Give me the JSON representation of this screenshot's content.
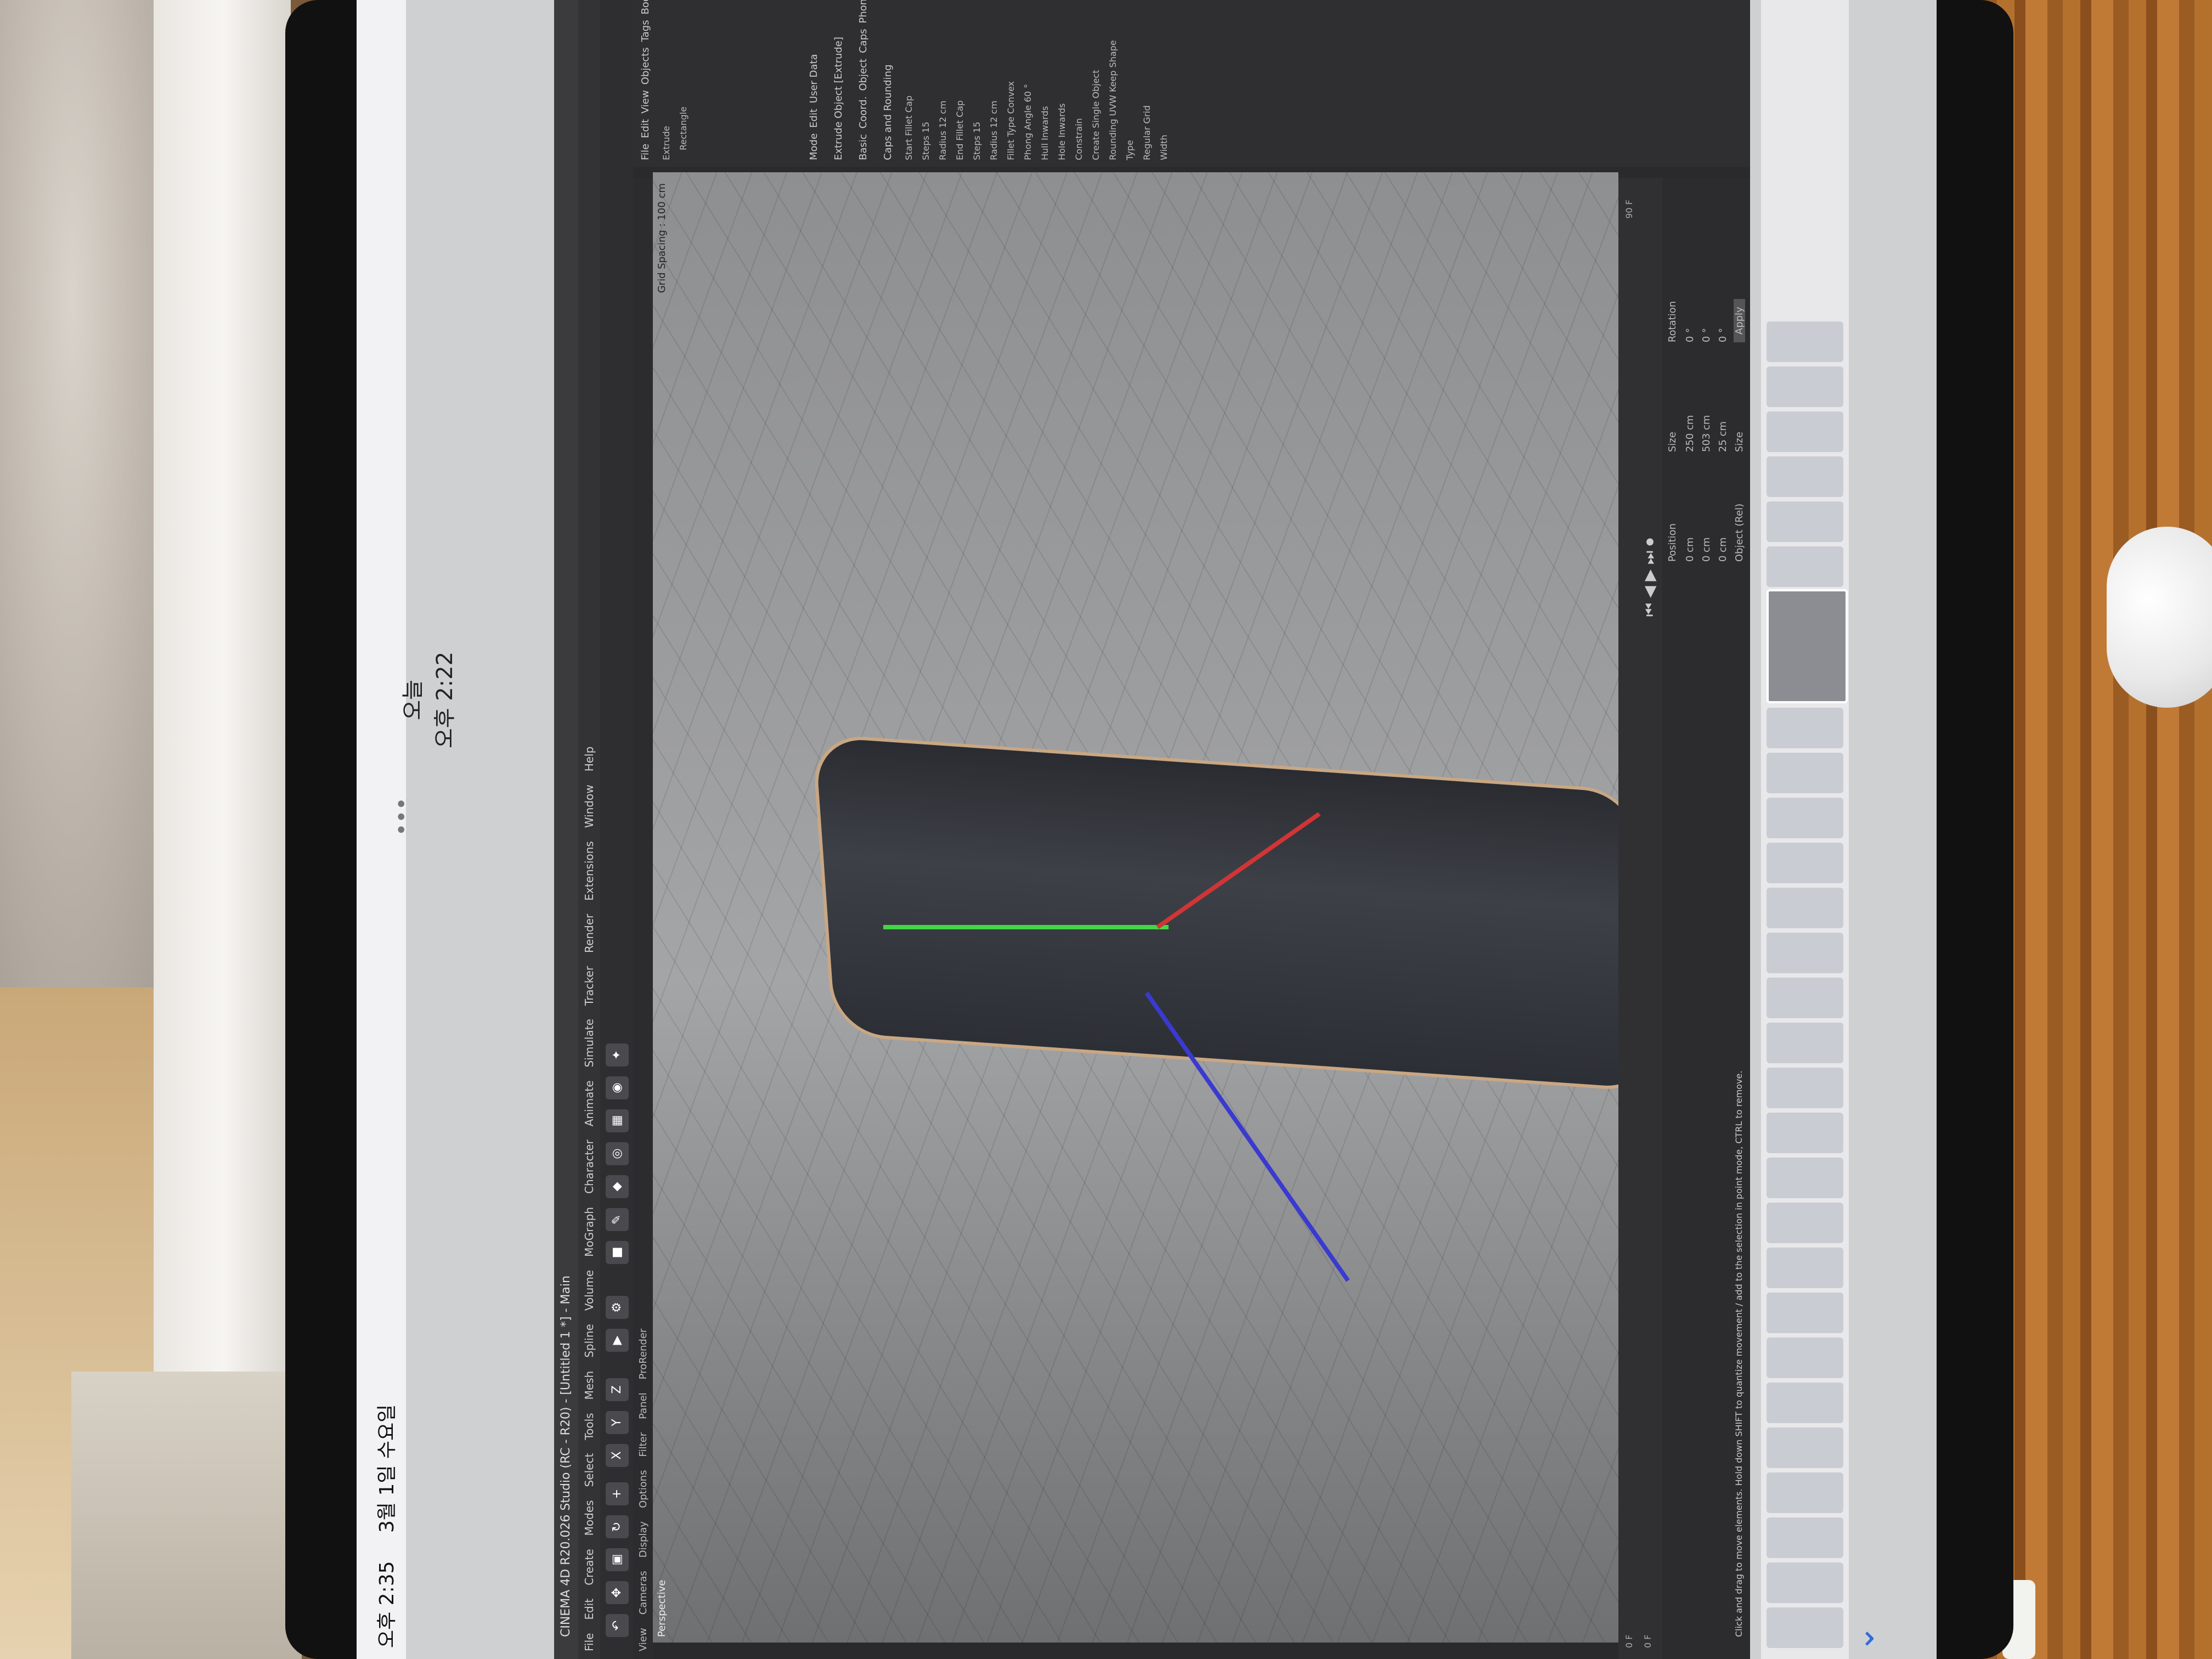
{
  "status": {
    "time": "오후 2:35",
    "date": "3월 1일 수요일"
  },
  "viewer": {
    "day": "오늘",
    "time": "오후 2:22"
  },
  "app": {
    "title": "CINEMA 4D R20.026 Studio (RC - R20) - [Untitled 1 *] - Main",
    "menus": [
      "File",
      "Edit",
      "Create",
      "Modes",
      "Select",
      "Tools",
      "Mesh",
      "Spline",
      "Volume",
      "MoGraph",
      "Character",
      "Animate",
      "Simulate",
      "Tracker",
      "Render",
      "Extensions",
      "Window",
      "Help"
    ],
    "view_menus": [
      "View",
      "Cameras",
      "Display",
      "Options",
      "Filter",
      "Panel",
      "ProRender"
    ],
    "viewport_label": "Perspective",
    "grid_spacing": "Grid Spacing : 100 cm",
    "axis_buttons": [
      "X",
      "Y",
      "Z"
    ],
    "timeline": {
      "start": "0 F",
      "end": "90 F",
      "current": "0 F"
    },
    "coords": {
      "position_label": "Position",
      "size_label": "Size",
      "rotation_label": "Rotation",
      "x": "0 cm",
      "y": "0 cm",
      "z": "0 cm",
      "sx": "250 cm",
      "sy": "503 cm",
      "sz": "25 cm",
      "h": "0 °",
      "p": "0 °",
      "b": "0 °",
      "mode": "Object (Rel)",
      "size_mode": "Size",
      "apply": "Apply"
    },
    "object_manager": {
      "menus": [
        "File",
        "Edit",
        "View",
        "Objects",
        "Tags",
        "Bookmarks"
      ],
      "items": [
        "Extrude",
        "Rectangle"
      ]
    },
    "attributes": {
      "menus": [
        "Mode",
        "Edit",
        "User Data"
      ],
      "object_title": "Extrude Object [Extrude]",
      "tabs": [
        "Basic",
        "Coord.",
        "Object",
        "Caps",
        "Phong"
      ],
      "section": "Caps and Rounding",
      "rows": [
        "Start",
        "Steps",
        "Radius",
        "End",
        "Steps",
        "Radius",
        "Fillet Type",
        "Phong Angle",
        "Hull Inwards",
        "Hole Inwards",
        "Constrain",
        "Create Single Object",
        "Rounding UVW Keep Shape",
        "Type",
        "Regular Grid",
        "Width"
      ],
      "values": [
        "Fillet Cap",
        "15",
        "12 cm",
        "Fillet Cap",
        "15",
        "12 cm",
        "Convex",
        "60 °"
      ]
    },
    "hint": "Click and drag to move elements. Hold down SHIFT to quantize movement / add to the selection in point mode, CTRL to remove."
  },
  "colors": {
    "x_axis": "#d03535",
    "y_axis": "#45d545",
    "z_axis": "#3a3ad0",
    "ios_blue": "#2d6cdf"
  }
}
